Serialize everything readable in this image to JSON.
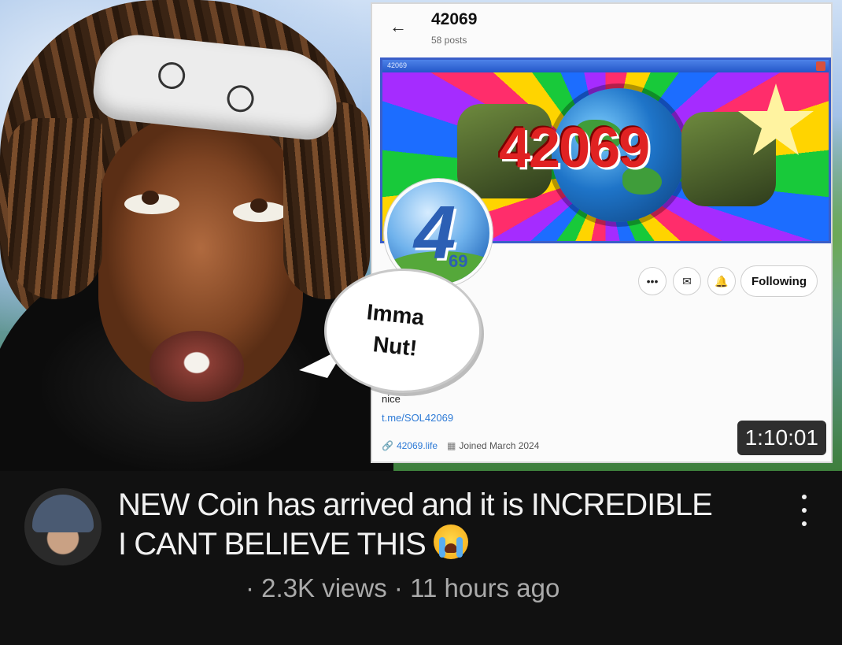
{
  "thumbnail": {
    "speech_bubble": {
      "line1": "Imma",
      "line2": "Nut!"
    },
    "duration": "1:10:01",
    "profile_card": {
      "name": "42069",
      "posts": "58 posts",
      "banner_window_title": "42069",
      "banner_title": "42069",
      "avatar_digit": "4",
      "avatar_sub": "69",
      "actions": {
        "more_label": "•••",
        "follow_label": "Following"
      },
      "bio": "nice",
      "bio_link": "t.me/SOL42069",
      "website": "42069.life",
      "joined": "Joined March 2024"
    }
  },
  "video": {
    "title_line1": "NEW Coin has arrived and it is INCREDIBLE",
    "title_line2": "I CANT BELIEVE THIS",
    "views": "2.3K views",
    "age": "11 hours ago",
    "meta_separator": "·"
  },
  "colors": {
    "background": "#0f0f0f",
    "title_text": "#f1f1f1",
    "meta_text": "#aaaaaa",
    "link_blue": "#2d7ad6",
    "banner_red": "#e02222"
  },
  "icons": [
    "back-arrow-icon",
    "mail-icon",
    "notify-icon",
    "link-icon",
    "calendar-icon",
    "crying-face-emoji",
    "more-vert-icon"
  ]
}
